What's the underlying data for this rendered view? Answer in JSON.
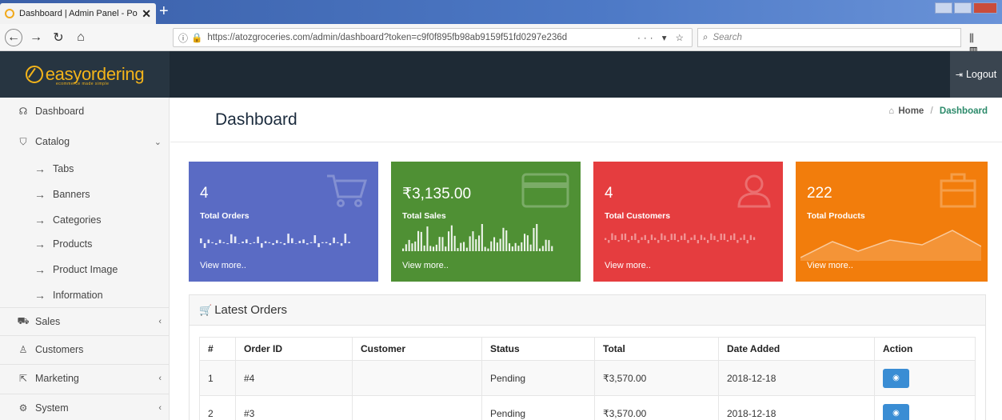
{
  "browser": {
    "tab_title": "Dashboard | Admin Panel - Po",
    "url": "https://atozgroceries.com/admin/dashboard?token=c9f0f895fb98ab9159f51fd0297e236d",
    "search_placeholder": "Search",
    "url_tools": "··· ▾ ☆",
    "right_tools": "⫼ ▥ ▦"
  },
  "header": {
    "brand": "easyordering",
    "brand_tagline": "ecommerce made simple",
    "logout_label": "Logout"
  },
  "sidebar": {
    "items": [
      {
        "label": "Dashboard",
        "icon": "dashboard-icon"
      },
      {
        "label": "Catalog",
        "icon": "tag-icon"
      },
      {
        "label": "Tabs"
      },
      {
        "label": "Banners"
      },
      {
        "label": "Categories"
      },
      {
        "label": "Products"
      },
      {
        "label": "Product Image"
      },
      {
        "label": "Information"
      },
      {
        "label": "Sales",
        "icon": "cart-icon"
      },
      {
        "label": "Customers",
        "icon": "user-icon"
      },
      {
        "label": "Marketing",
        "icon": "share-icon"
      },
      {
        "label": "System",
        "icon": "gear-icon"
      }
    ]
  },
  "page": {
    "title": "Dashboard",
    "breadcrumb": {
      "home": "Home",
      "current": "Dashboard"
    }
  },
  "cards": [
    {
      "value": "4",
      "label": "Total Orders",
      "more": "View more..",
      "color": "#5a6bc4"
    },
    {
      "value": "₹3,135.00",
      "label": "Total Sales",
      "more": "View more..",
      "color": "#4f9034"
    },
    {
      "value": "4",
      "label": "Total Customers",
      "more": "View more..",
      "color": "#e53d3f"
    },
    {
      "value": "222",
      "label": "Total Products",
      "more": "View more..",
      "color": "#f27d0c"
    }
  ],
  "orders": {
    "title": "Latest Orders",
    "columns": [
      "#",
      "Order ID",
      "Customer",
      "Status",
      "Total",
      "Date Added",
      "Action"
    ],
    "rows": [
      {
        "n": "1",
        "id": "#4",
        "customer": "",
        "status": "Pending",
        "total": "₹3,570.00",
        "date": "2018-12-18"
      },
      {
        "n": "2",
        "id": "#3",
        "customer": "",
        "status": "Pending",
        "total": "₹3,570.00",
        "date": "2018-12-18"
      }
    ]
  }
}
